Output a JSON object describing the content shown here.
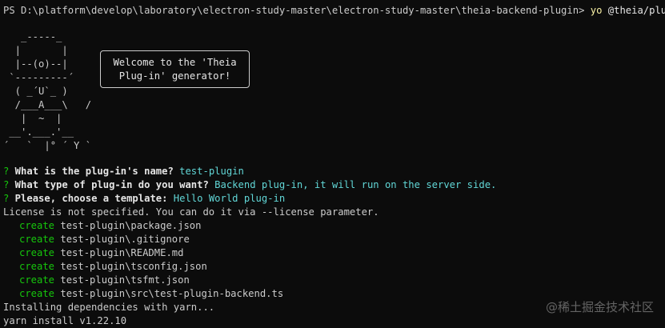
{
  "prompt": {
    "prefix": "PS D:\\platform\\develop\\laboratory\\electron-study-master\\electron-study-master\\theia-backend-plugin> ",
    "command": "yo",
    "argument": " @theia/plugin"
  },
  "ascii_art": "   _-----_\n  |       |\n  |--(o)--|\n `---------´\n  ( _´U`_ )\n  /___A___\\   /\n   |  ~  |\n __'.___.'__\n´   `  |° ´ Y `",
  "welcome": {
    "line1": "Welcome to the 'Theia",
    "line2": "Plug-in' generator!"
  },
  "questions": [
    {
      "mark": "?",
      "question": " What is the plug-in's name?",
      "answer": " test-plugin"
    },
    {
      "mark": "?",
      "question": " What type of plug-in do you want?",
      "answer": " Backend plug-in, it will run on the server side."
    },
    {
      "mark": "?",
      "question": " Please, choose a template:",
      "answer": " Hello World plug-in"
    }
  ],
  "license_note": "License is not specified. You can do it via --license parameter.",
  "create_label": "create",
  "created_files": [
    "test-plugin\\package.json",
    "test-plugin\\.gitignore",
    "test-plugin\\README.md",
    "test-plugin\\tsconfig.json",
    "test-plugin\\tsfmt.json",
    "test-plugin\\src\\test-plugin-backend.ts"
  ],
  "install_status": "Installing dependencies with yarn...",
  "yarn_line": "yarn install v1.22.10",
  "watermark": "@稀土掘金技术社区",
  "colors": {
    "background": "#0c0c0c",
    "text": "#cccccc",
    "command": "#f9f1a5",
    "answer": "#61d6d6",
    "create": "#16c60c"
  }
}
